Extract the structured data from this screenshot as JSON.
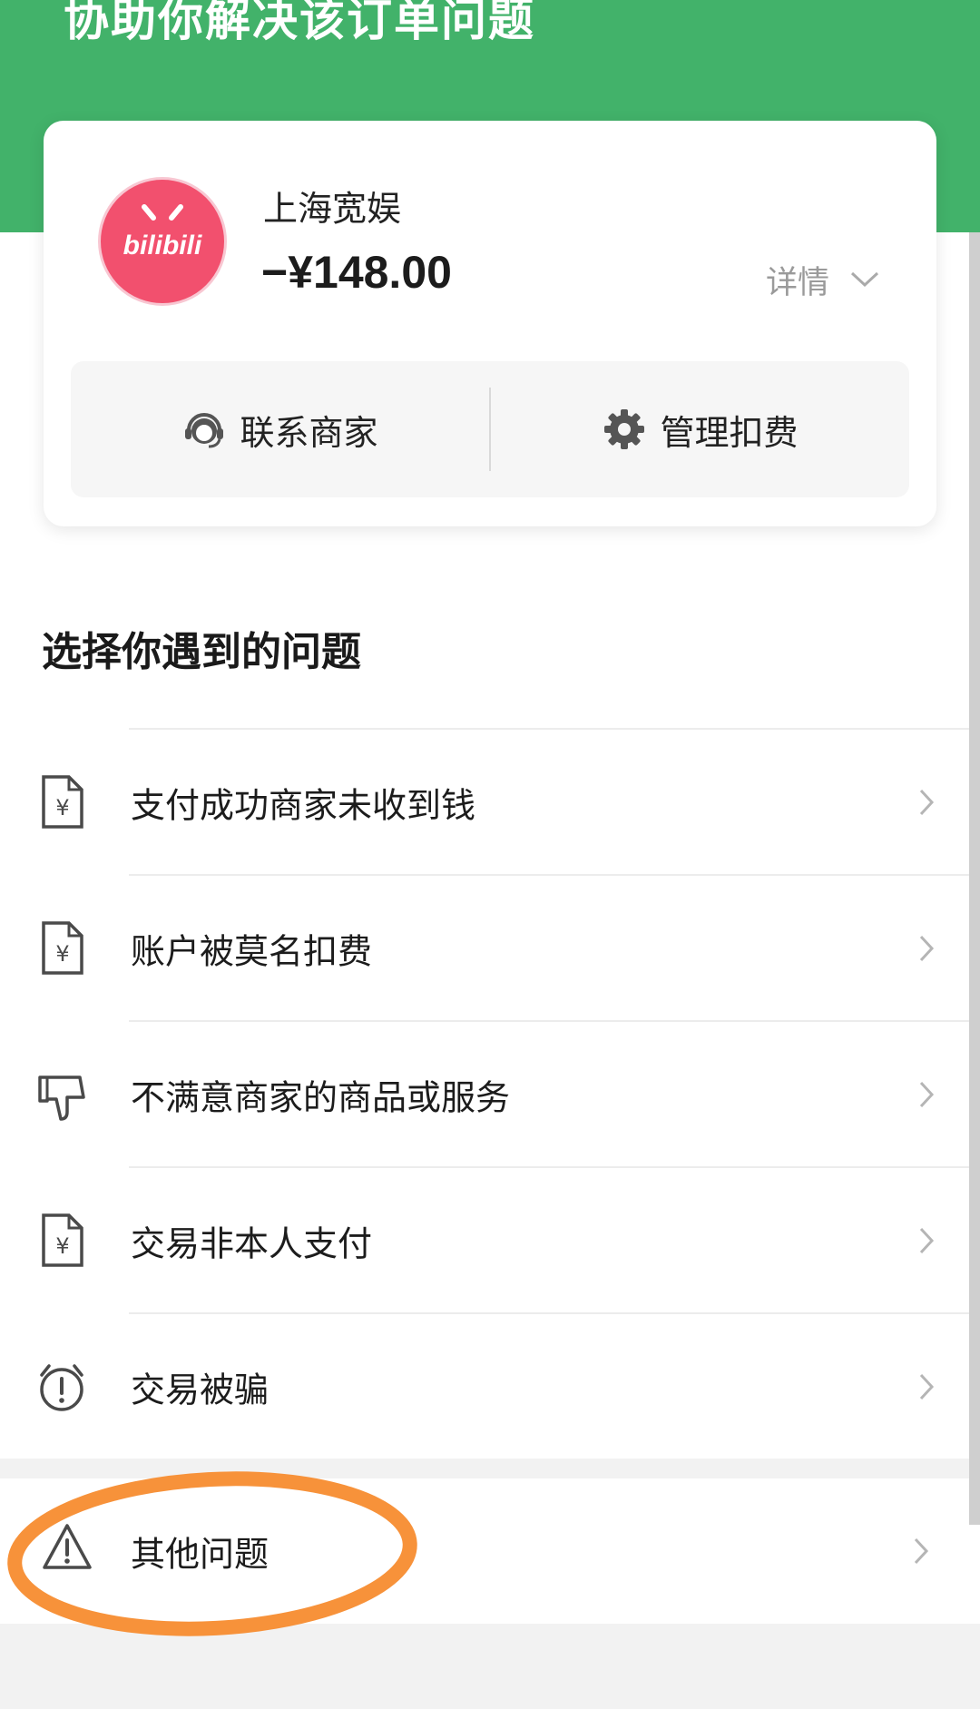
{
  "header": {
    "banner_text": "协助你解决该订单问题",
    "background_color": "#42b26a"
  },
  "order": {
    "merchant_logo": "bilibili-logo",
    "merchant_logo_text": "bilibili",
    "merchant_name": "上海宽娱",
    "amount": "−¥148.00",
    "detail_label": "详情",
    "detail_icon": "chevron-down-icon",
    "actions": [
      {
        "label": "联系商家",
        "icon": "headset-icon"
      },
      {
        "label": "管理扣费",
        "icon": "gear-icon"
      }
    ]
  },
  "issues": {
    "title": "选择你遇到的问题",
    "items": [
      {
        "label": "支付成功商家未收到钱",
        "icon": "yuan-document-icon"
      },
      {
        "label": "账户被莫名扣费",
        "icon": "yuan-document-icon"
      },
      {
        "label": "不满意商家的商品或服务",
        "icon": "thumbs-down-icon"
      },
      {
        "label": "交易非本人支付",
        "icon": "yuan-document-icon"
      },
      {
        "label": "交易被骗",
        "icon": "alarm-clock-warning-icon"
      }
    ],
    "other": {
      "label": "其他问题",
      "icon": "warning-triangle-icon"
    }
  },
  "annotation": {
    "highlight_color": "#f7923a"
  }
}
